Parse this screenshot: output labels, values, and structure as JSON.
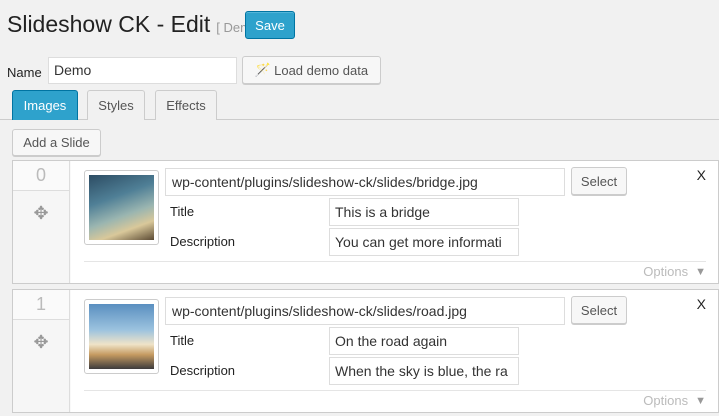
{
  "header": {
    "title": "Slideshow CK - Edit",
    "subtitle": "[ Demo ]",
    "save_label": "Save"
  },
  "name_field": {
    "label": "Name",
    "value": "Demo"
  },
  "load_demo_label": "Load demo data",
  "tabs": [
    {
      "label": "Images",
      "active": true
    },
    {
      "label": "Styles",
      "active": false
    },
    {
      "label": "Effects",
      "active": false
    }
  ],
  "add_slide_label": "Add a Slide",
  "slides": [
    {
      "index": "0",
      "image_path": "wp-content/plugins/slideshow-ck/slides/bridge.jpg",
      "select_label": "Select",
      "remove_label": "X",
      "title_label": "Title",
      "title_value": "This is a bridge",
      "description_label": "Description",
      "description_value": "You can get more informati",
      "options_label": "Options"
    },
    {
      "index": "1",
      "image_path": "wp-content/plugins/slideshow-ck/slides/road.jpg",
      "select_label": "Select",
      "remove_label": "X",
      "title_label": "Title",
      "title_value": "On the road again",
      "description_label": "Description",
      "description_value": "When the sky is blue, the ra",
      "options_label": "Options"
    }
  ],
  "icons": {
    "wand": "magic-wand-icon",
    "move": "move-arrows-icon",
    "caret": "caret-down-icon"
  },
  "colors": {
    "primary": "#2ea2cc",
    "primary_border": "#0074a2",
    "background": "#f1f1f1"
  }
}
